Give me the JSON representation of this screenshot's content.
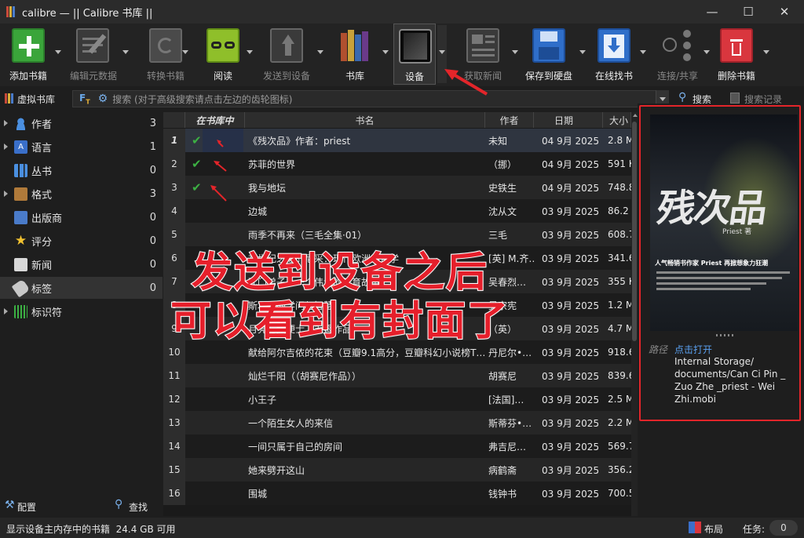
{
  "window": {
    "title": "calibre — || Calibre 书库 ||"
  },
  "toolbar": {
    "buttons": [
      {
        "label": "添加书籍",
        "icon": "add-book-icon",
        "enabled": true
      },
      {
        "label": "编辑元数据",
        "icon": "edit-metadata-icon",
        "enabled": false
      },
      {
        "label": "转换书籍",
        "icon": "convert-books-icon",
        "enabled": false
      },
      {
        "label": "阅读",
        "icon": "read-book-icon",
        "enabled": true
      },
      {
        "label": "发送到设备",
        "icon": "send-to-device-icon",
        "enabled": false
      },
      {
        "label": "书库",
        "icon": "library-icon",
        "enabled": true
      },
      {
        "label": "设备",
        "icon": "device-icon",
        "enabled": true
      },
      {
        "label": "获取新闻",
        "icon": "fetch-news-icon",
        "enabled": false
      },
      {
        "label": "保存到硬盘",
        "icon": "save-to-disk-icon",
        "enabled": true
      },
      {
        "label": "在线找书",
        "icon": "get-books-icon",
        "enabled": true
      },
      {
        "label": "连接/共享",
        "icon": "connect-share-icon",
        "enabled": false
      },
      {
        "label": "删除书籍",
        "icon": "remove-books-icon",
        "enabled": true
      }
    ]
  },
  "search": {
    "virtual_library": "虚拟书库",
    "placeholder": "搜索 (对于高级搜索请点击左边的齿轮图标)",
    "search_button": "搜索",
    "saved_searches": "搜索记录"
  },
  "tag_browser": {
    "items": [
      {
        "name": "作者",
        "count": "3",
        "expandable": true,
        "icon": "authors-icon"
      },
      {
        "name": "语言",
        "count": "1",
        "expandable": true,
        "icon": "languages-icon"
      },
      {
        "name": "丛书",
        "count": "0",
        "expandable": false,
        "icon": "series-icon"
      },
      {
        "name": "格式",
        "count": "3",
        "expandable": true,
        "icon": "formats-icon"
      },
      {
        "name": "出版商",
        "count": "0",
        "expandable": false,
        "icon": "publisher-icon"
      },
      {
        "name": "评分",
        "count": "0",
        "expandable": false,
        "icon": "rating-icon"
      },
      {
        "name": "新闻",
        "count": "0",
        "expandable": false,
        "icon": "news-icon"
      },
      {
        "name": "标签",
        "count": "0",
        "expandable": false,
        "icon": "tags-icon"
      },
      {
        "name": "标识符",
        "count": "",
        "expandable": true,
        "icon": "identifiers-icon"
      }
    ],
    "configure": "配置",
    "find": "查找"
  },
  "table": {
    "columns": [
      "在书库中",
      "书名",
      "作者",
      "日期",
      "大小"
    ],
    "rows": [
      {
        "n": "1",
        "in_lib": true,
        "title": "《残次品》作者：priest",
        "author": "未知",
        "date": "04 9月 2025",
        "size": "2.8 M"
      },
      {
        "n": "2",
        "in_lib": true,
        "title": "苏菲的世界",
        "author": "（挪）",
        "date": "04 9月 2025",
        "size": "591 K"
      },
      {
        "n": "3",
        "in_lib": true,
        "title": "我与地坛",
        "author": "史铁生",
        "date": "04 9月 2025",
        "size": "748.8"
      },
      {
        "n": "4",
        "in_lib": false,
        "title": "边城",
        "author": "沈从文",
        "date": "03 9月 2025",
        "size": "86.2"
      },
      {
        "n": "5",
        "in_lib": false,
        "title": "雨季不再来（三毛全集·01）",
        "author": "三毛",
        "date": "03 9月 2025",
        "size": "608.7"
      },
      {
        "n": "6",
        "in_lib": false,
        "title": "在世纪之巅的尼采：现代欧洲的哲学",
        "author": "[英] M.齐…",
        "date": "03 9月 2025",
        "size": "341.6"
      },
      {
        "n": "7",
        "in_lib": false,
        "title": "孔门弟子：一个伟大的教育故事",
        "author": "吴春烈…",
        "date": "03 9月 2025",
        "size": "355 K"
      },
      {
        "n": "8",
        "in_lib": false,
        "title": "斯坦福的学问与智慧",
        "author": "吴宗宪",
        "date": "03 9月 2025",
        "size": "1.2 M"
      },
      {
        "n": "9",
        "in_lib": false,
        "title": "月亮与六便士（毛姆作品）",
        "author": "（英）",
        "date": "03 9月 2025",
        "size": "4.7 M"
      },
      {
        "n": "10",
        "in_lib": false,
        "title": "献给阿尔吉侬的花束（豆瓣9.1高分，豆瓣科幻小说榜T…",
        "author": "丹尼尔•…",
        "date": "03 9月 2025",
        "size": "918.6"
      },
      {
        "n": "11",
        "in_lib": false,
        "title": "灿烂千阳（（胡赛尼作品））",
        "author": "胡赛尼",
        "date": "03 9月 2025",
        "size": "839.6"
      },
      {
        "n": "12",
        "in_lib": false,
        "title": "小王子",
        "author": "[法国]…",
        "date": "03 9月 2025",
        "size": "2.5 M"
      },
      {
        "n": "13",
        "in_lib": false,
        "title": "一个陌生女人的来信",
        "author": "斯蒂芬•…",
        "date": "03 9月 2025",
        "size": "2.2 M"
      },
      {
        "n": "14",
        "in_lib": false,
        "title": "一间只属于自己的房间",
        "author": "弗吉尼…",
        "date": "03 9月 2025",
        "size": "569.7"
      },
      {
        "n": "15",
        "in_lib": false,
        "title": "她来劈开这山",
        "author": "病鹤斋",
        "date": "03 9月 2025",
        "size": "356.2"
      },
      {
        "n": "16",
        "in_lib": false,
        "title": "围城",
        "author": "钱钟书",
        "date": "03 9月 2025",
        "size": "700.5"
      }
    ]
  },
  "details": {
    "cover_title": "残次品",
    "cover_author": "Priest 著",
    "cover_tagline": "人气畅销书作家 Priest 再掀想象力狂潮",
    "path_label": "路径",
    "path_link": "点击打开",
    "path_value": "Internal Storage/ documents/Can Ci Pin _ Zuo Zhe _priest - Wei Zhi.mobi"
  },
  "annotation": {
    "line1": "发送到设备之后",
    "line2": "可以看到有封面了"
  },
  "statusbar": {
    "message": "显示设备主内存中的书籍  24.4 GB 可用",
    "layout": "布局",
    "jobs_label": "任务:",
    "jobs_count": "0"
  },
  "colors": {
    "accent_red": "#e3252a",
    "check_green": "#3cb043",
    "link_blue": "#5aa0f0"
  }
}
